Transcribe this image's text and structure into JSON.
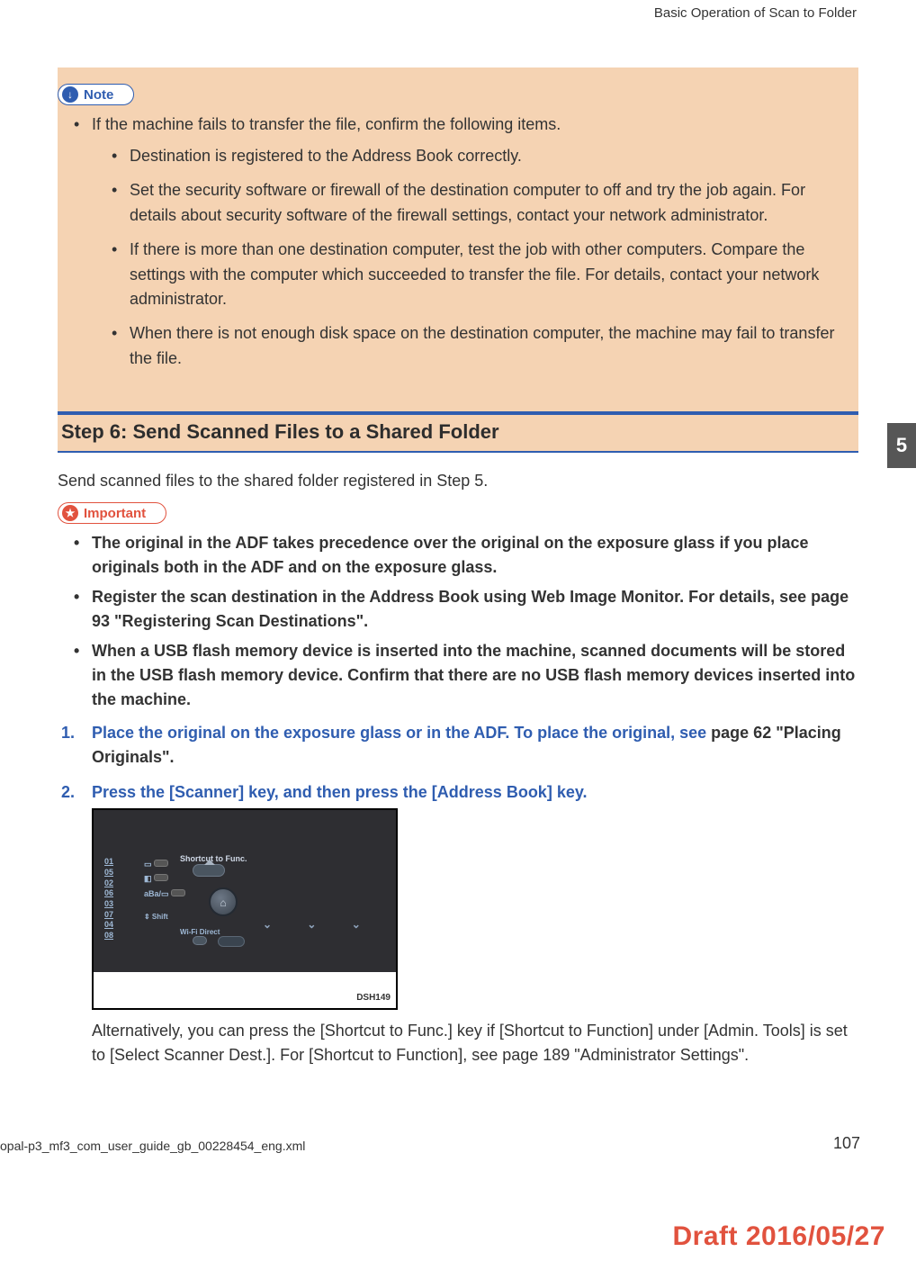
{
  "header": {
    "running": "Basic Operation of Scan to Folder"
  },
  "note": {
    "badge": "Note",
    "intro": "If the machine fails to transfer the file, confirm the following items.",
    "items": [
      "Destination is registered to the Address Book correctly.",
      "Set the security software or firewall of the destination computer to off and try the job again. For details about security software of the firewall settings, contact your network administrator.",
      "If there is more than one destination computer, test the job with other computers. Compare the settings with the computer which succeeded to transfer the file. For details, contact your network administrator.",
      "When there is not enough disk space on the destination computer, the machine may fail to transfer the file."
    ]
  },
  "step6": {
    "heading": "Step 6: Send Scanned Files to a Shared Folder",
    "intro": "Send scanned files to the shared folder registered in Step 5."
  },
  "important": {
    "badge": "Important",
    "items": [
      "The original in the ADF takes precedence over the original on the exposure glass if you place originals both in the ADF and on the exposure glass.",
      "Register the scan destination in the Address Book using Web Image Monitor. For details, see page 93 \"Registering Scan Destinations\".",
      "When a USB flash memory device is inserted into the machine, scanned documents will be stored in the USB flash memory device. Confirm that there are no USB flash memory devices inserted into the machine."
    ]
  },
  "steps": {
    "s1_num": "1.",
    "s1_a": "Place the original on the exposure glass or in the ADF. To place the original, see ",
    "s1_b": "page 62 \"Placing Originals\".",
    "s2_num": "2.",
    "s2": "Press the [Scanner] key, and then press the [Address Book] key.",
    "s2_sub": "Alternatively, you can press the [Shortcut to Func.] key if [Shortcut to Function] under [Admin. Tools] is set to [Select Scanner Dest.]. For [Shortcut to Function], see page 189 \"Administrator Settings\"."
  },
  "figure": {
    "shortcut_label": "Shortcut to Func.",
    "wifi_label": "Wi-Fi Direct",
    "shift_label": "⇕ Shift",
    "dials": [
      "01",
      "05",
      "02",
      "06",
      "03",
      "07",
      "04",
      "08"
    ],
    "code": "DSH149"
  },
  "tab": "5",
  "footer": {
    "left": "opal-p3_mf3_com_user_guide_gb_00228454_eng.xml",
    "page": "107",
    "draft": "Draft 2016/05/27"
  }
}
